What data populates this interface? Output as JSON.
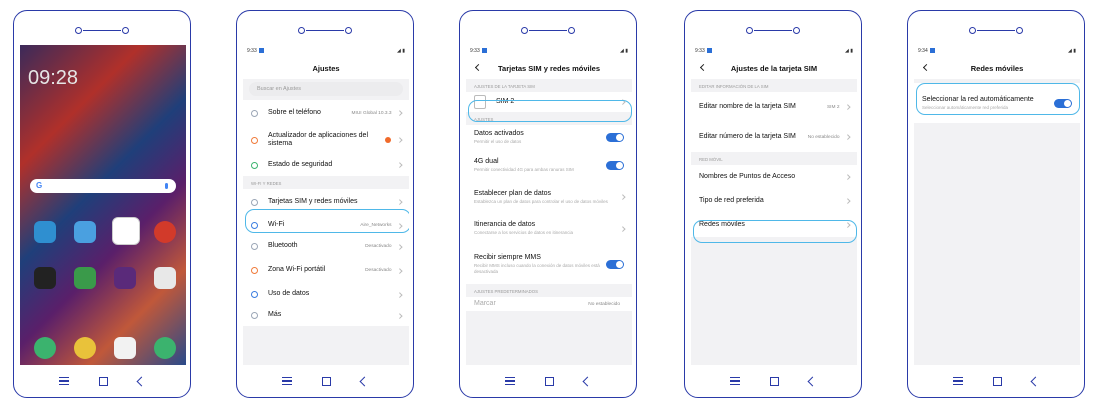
{
  "phones": [
    {
      "screen": "home",
      "clock": "09:28",
      "search_letter": "G"
    },
    {
      "screen": "settings",
      "status_time": "9:33",
      "title": "Ajustes",
      "search_placeholder": "Buscar en Ajustes",
      "items": [
        {
          "label": "Sobre el teléfono",
          "value": "MIUI Global 10.3.3"
        },
        {
          "label": "Actualizador de aplicaciones del sistema",
          "value": ""
        },
        {
          "label": "Estado de seguridad",
          "value": ""
        }
      ],
      "section": "WI-FI Y REDES",
      "net_items": [
        {
          "label": "Tarjetas SIM y redes móviles",
          "value": ""
        },
        {
          "label": "Wi-Fi",
          "value": "Aire_Networks"
        },
        {
          "label": "Bluetooth",
          "value": "Desactivado"
        },
        {
          "label": "Zona Wi-Fi portátil",
          "value": "Desactivado"
        },
        {
          "label": "Uso de datos",
          "value": ""
        },
        {
          "label": "Más",
          "value": ""
        }
      ]
    },
    {
      "screen": "sim",
      "status_time": "9:33",
      "title": "Tarjetas SIM y redes móviles",
      "section1": "AJUSTES DE LA TARJETA SIM",
      "sim": "SIM 2",
      "section2": "AJUSTES",
      "items": [
        {
          "label": "Datos activados",
          "sub": "Permitir el uso de datos",
          "toggle": true
        },
        {
          "label": "4G dual",
          "sub": "Permitir conectividad 4G para ambas ranuras SIM",
          "toggle": true
        },
        {
          "label": "Establecer plan de datos",
          "sub": "Establezca un plan de datos para controlar el uso de datos móviles",
          "toggle": false
        },
        {
          "label": "Itinerancia de datos",
          "sub": "Conectarse a los servicios de datos en itinerancia",
          "toggle": false
        },
        {
          "label": "Recibir siempre MMS",
          "sub": "Recibir MMS incluso cuando la conexión de datos móviles está desactivada",
          "toggle": true
        }
      ],
      "section3": "AJUSTES PREDETERMINADOS",
      "last_label": "Marcar",
      "last_value": "No establecido"
    },
    {
      "screen": "sim-settings",
      "status_time": "9:33",
      "title": "Ajustes de la tarjeta SIM",
      "section1": "EDITAR INFORMACIÓN DE LA SIM",
      "items": [
        {
          "label": "Editar nombre de la tarjeta SIM",
          "value": "SIM 2"
        },
        {
          "label": "Editar número de la tarjeta SIM",
          "value": "No establecido"
        }
      ],
      "section2": "RED MÓVIL",
      "net_items": [
        {
          "label": "Nombres de Puntos de Acceso"
        },
        {
          "label": "Tipo de red preferida"
        },
        {
          "label": "Redes móviles"
        }
      ]
    },
    {
      "screen": "mobile-networks",
      "status_time": "9:34",
      "title": "Redes móviles",
      "item_label": "Seleccionar la red automáticamente",
      "item_sub": "Seleccionar automáticamente red preferida",
      "toggle": true
    }
  ],
  "colors": {
    "outline": "#2a3aa8",
    "highlight": "#4fb8e8",
    "toggle": "#2b6fd6"
  }
}
